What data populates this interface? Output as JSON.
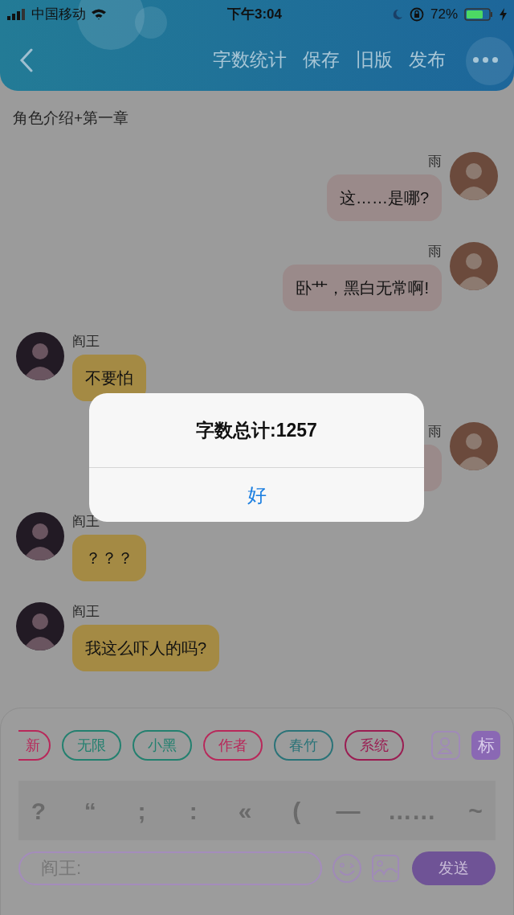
{
  "status_bar": {
    "carrier": "中国移动",
    "time": "下午3:04",
    "battery": "72%"
  },
  "header": {
    "actions": [
      "字数统计",
      "保存",
      "旧版",
      "发布"
    ]
  },
  "chapter_title": "角色介绍+第一章",
  "messages": [
    {
      "kind": "outgoing",
      "sender": "雨",
      "text": "这……是哪?"
    },
    {
      "kind": "outgoing",
      "sender": "雨",
      "text": "卧艹，黑白无常啊!"
    },
    {
      "kind": "incoming",
      "sender": "阎王",
      "text": "不要怕"
    },
    {
      "kind": "outgoing",
      "sender": "雨"
    },
    {
      "kind": "incoming",
      "sender": "阎王",
      "text": "？？？"
    },
    {
      "kind": "incoming",
      "sender": "阎王",
      "text": "我这么吓人的吗?"
    }
  ],
  "alert": {
    "title": "字数总计:1257",
    "button": "好"
  },
  "tags": [
    {
      "label": "新",
      "color": "#b8285a"
    },
    {
      "label": "无限",
      "color": "#23806f"
    },
    {
      "label": "小黑",
      "color": "#23806f"
    },
    {
      "label": "作者",
      "color": "#b8285a"
    },
    {
      "label": "春竹",
      "color": "#2a7378"
    },
    {
      "label": "系统",
      "color": "#9a1d52"
    }
  ],
  "side_buttons": {
    "mark": "标"
  },
  "punctuation": [
    "?",
    "“",
    ";",
    ":",
    "«",
    "(",
    "—",
    "……",
    "~"
  ],
  "input": {
    "placeholder": "阎王:"
  },
  "send_button": "发送"
}
